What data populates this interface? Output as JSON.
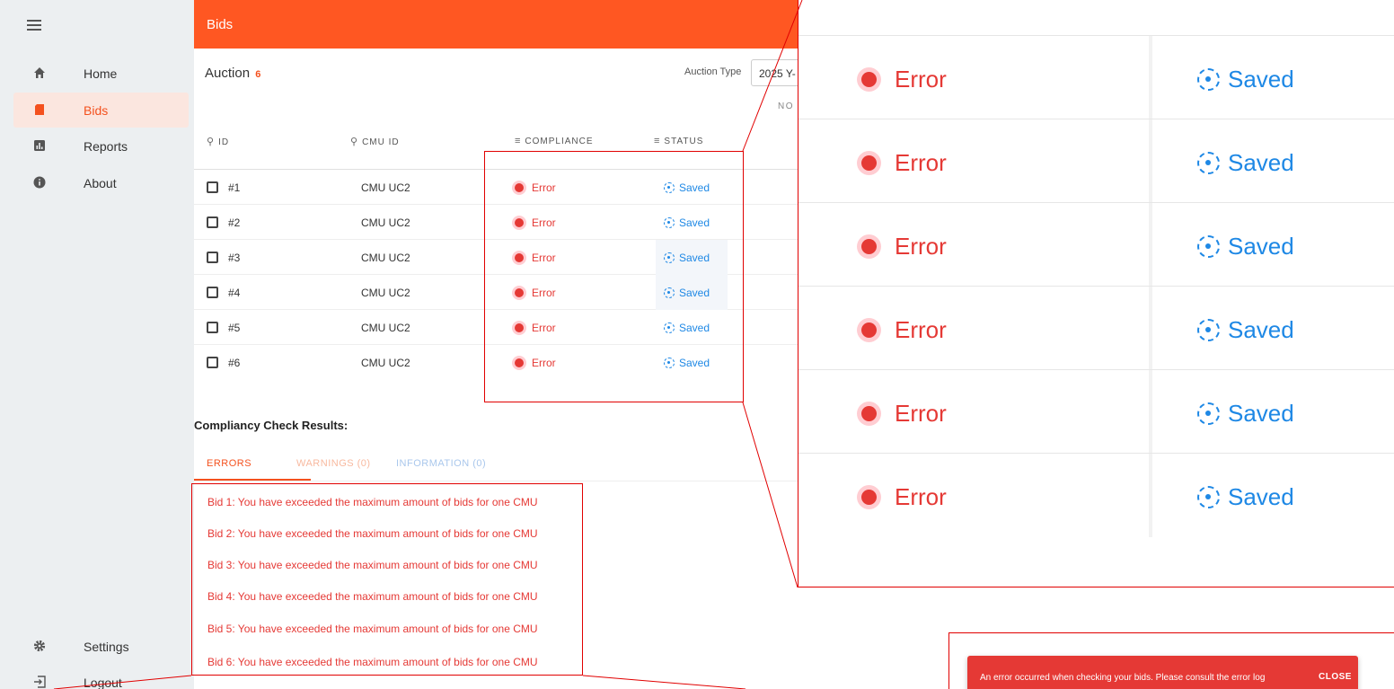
{
  "topbar": {
    "title": "Bids"
  },
  "sidebar": {
    "items": [
      {
        "label": "Home",
        "icon": "home-icon",
        "active": false
      },
      {
        "label": "Bids",
        "icon": "bids-icon",
        "active": true
      },
      {
        "label": "Reports",
        "icon": "reports-icon",
        "active": false
      },
      {
        "label": "About",
        "icon": "info-icon",
        "active": false
      }
    ],
    "bottom_items": [
      {
        "label": "Settings",
        "icon": "gear-icon"
      },
      {
        "label": "Logout",
        "icon": "logout-icon"
      }
    ]
  },
  "auction": {
    "title": "Auction",
    "count": "6",
    "type_label": "Auction Type",
    "type_value": "2025 Y-",
    "partial_text": "NO F"
  },
  "table": {
    "headers": {
      "id": "ID",
      "cmu_id": "CMU ID",
      "compliance": "COMPLIANCE",
      "status": "STATUS"
    },
    "rows": [
      {
        "id": "#1",
        "cmu": "CMU UC2",
        "compliance": "Error",
        "status": "Saved"
      },
      {
        "id": "#2",
        "cmu": "CMU UC2",
        "compliance": "Error",
        "status": "Saved"
      },
      {
        "id": "#3",
        "cmu": "CMU UC2",
        "compliance": "Error",
        "status": "Saved"
      },
      {
        "id": "#4",
        "cmu": "CMU UC2",
        "compliance": "Error",
        "status": "Saved"
      },
      {
        "id": "#5",
        "cmu": "CMU UC2",
        "compliance": "Error",
        "status": "Saved"
      },
      {
        "id": "#6",
        "cmu": "CMU UC2",
        "compliance": "Error",
        "status": "Saved"
      }
    ]
  },
  "results": {
    "title": "Compliancy Check Results:",
    "tabs": {
      "errors": "ERRORS",
      "warnings": "WARNINGS (0)",
      "information": "INFORMATION (0)"
    },
    "errors": [
      "Bid 1: You have exceeded the maximum amount of bids for one CMU",
      "Bid 2: You have exceeded the maximum amount of bids for one CMU",
      "Bid 3: You have exceeded the maximum amount of bids for one CMU",
      "Bid 4: You have exceeded the maximum amount of bids for one CMU",
      "Bid 5: You have exceeded the maximum amount of bids for one CMU",
      "Bid 6: You have exceeded the maximum amount of bids for one CMU"
    ]
  },
  "zoom": {
    "rows": [
      {
        "compliance": "Error",
        "status": "Saved"
      },
      {
        "compliance": "Error",
        "status": "Saved"
      },
      {
        "compliance": "Error",
        "status": "Saved"
      },
      {
        "compliance": "Error",
        "status": "Saved"
      },
      {
        "compliance": "Error",
        "status": "Saved"
      },
      {
        "compliance": "Error",
        "status": "Saved"
      }
    ]
  },
  "snackbar": {
    "message": "An error occurred when checking your bids. Please consult the error log",
    "close_label": "CLOSE"
  },
  "colors": {
    "accent": "#ff5722",
    "error": "#e53935",
    "saved": "#1e88e5",
    "annotation": "#e10000"
  }
}
